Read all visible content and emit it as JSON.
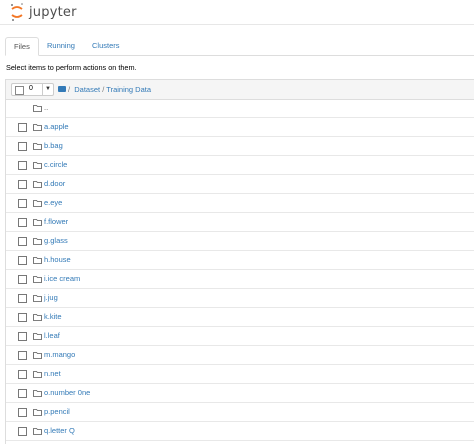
{
  "app": {
    "logo_text": "jupyter"
  },
  "tabs": [
    {
      "label": "Files",
      "active": true
    },
    {
      "label": "Running",
      "active": false
    },
    {
      "label": "Clusters",
      "active": false
    }
  ],
  "hint": "Select items to perform actions on them.",
  "toolbar": {
    "selected_count": "0"
  },
  "breadcrumb": {
    "root": "/",
    "items": [
      "Dataset",
      "Training Data"
    ],
    "separator": "/"
  },
  "parent_dir": "..",
  "folders": [
    "a.apple",
    "b.bag",
    "c.circle",
    "d.door",
    "e.eye",
    "f.flower",
    "g.glass",
    "h.house",
    "i.ice cream",
    "j.jug",
    "k.kite",
    "l.leaf",
    "m.mango",
    "n.net",
    "o.number 0ne",
    "p.pencil",
    "q.letter Q"
  ],
  "colors": {
    "link": "#337ab7",
    "logo_orange": "#f37726"
  }
}
